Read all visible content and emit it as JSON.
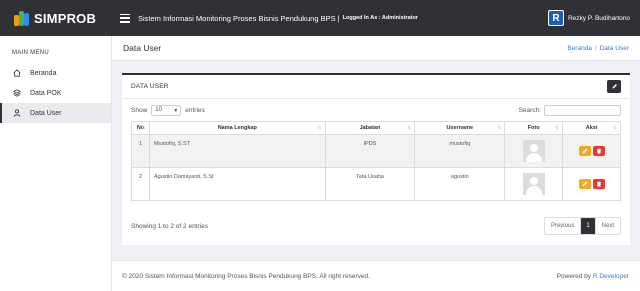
{
  "brand": {
    "name": "SIMPROB"
  },
  "header": {
    "app_title": "Sistem Informasi Monitoring Proses Bisnis Pendukung BPS |",
    "logged_in": "Logged In As : Administrator",
    "user_initial": "R",
    "user_name": "Rezky P. Budihartono"
  },
  "sidebar": {
    "title": "MAIN MENU",
    "items": [
      {
        "label": "Beranda",
        "icon": "home-icon"
      },
      {
        "label": "Data POK",
        "icon": "layers-icon"
      },
      {
        "label": "Data User",
        "icon": "user-icon",
        "active": true
      }
    ]
  },
  "page": {
    "title": "Data User",
    "breadcrumb": {
      "home": "Beranda",
      "sep": "/",
      "current": "Data User"
    }
  },
  "card": {
    "title": "DATA USER",
    "show_label": "Show",
    "entries_value": "10",
    "entries_label": "entries",
    "search_label": "Search:",
    "search_value": "",
    "columns": [
      "No",
      "Nama Lengkap",
      "Jabatan",
      "Username",
      "Foto",
      "Aksi"
    ],
    "rows": [
      {
        "no": "1",
        "nama": "Mustofiq, S.ST",
        "jabatan": "IPDS",
        "username": "mustofiq"
      },
      {
        "no": "2",
        "nama": "Agustin Damayanti, S.St",
        "jabatan": "Tata Usaha",
        "username": "agustin"
      }
    ],
    "info": "Showing 1 to 2 of 2 entries",
    "pager": {
      "prev": "Previous",
      "current": "1",
      "next": "Next"
    }
  },
  "footer": {
    "left": "© 2020 Sistem Informasi Monitoring Proses Bisnis Pendukung BPS. All right reserved.",
    "right_prefix": "Powered by",
    "right_link": "R Developer"
  },
  "colors": {
    "topbar": "#2f3136",
    "link": "#3a7bd5",
    "edit": "#f5a623",
    "delete": "#e53935"
  }
}
